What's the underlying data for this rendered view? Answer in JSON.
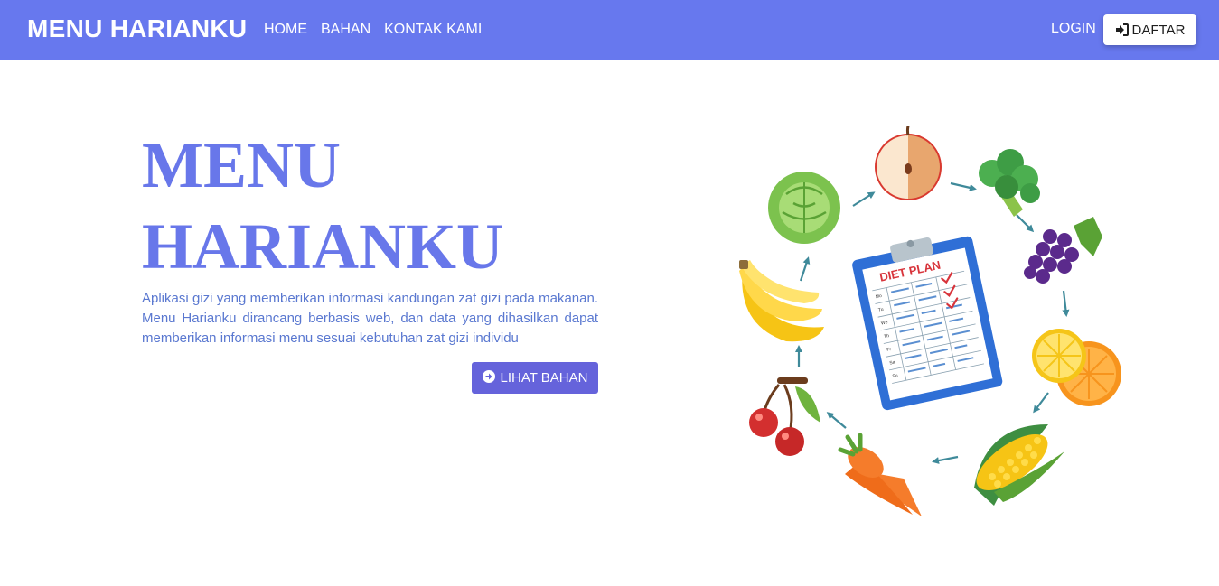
{
  "navbar": {
    "brand": "MENU HARIANKU",
    "links": [
      "HOME",
      "BAHAN",
      "KONTAK KAMI"
    ],
    "login": "LOGIN",
    "register": "DAFTAR",
    "register_icon": "sign-in-icon",
    "background": "#6778ee"
  },
  "hero": {
    "title_line1": "MENU",
    "title_line2": "HARIANKU",
    "description": "Aplikasi gizi yang memberikan informasi kandungan zat gizi pada makanan. Menu Harianku dirancang berbasis web, dan data yang dihasilkan dapat memberikan informasi menu sesuai kebutuhan zat gizi individu",
    "button_label": "LIHAT BAHAN",
    "button_icon": "arrow-circle-right-icon",
    "title_color": "#6877ea",
    "button_color": "#6563db"
  },
  "illustration": {
    "clipboard_title": "DIET PLAN",
    "day_labels": [
      "Mo",
      "Tu",
      "We",
      "Th",
      "Fr",
      "Sa",
      "Su"
    ],
    "items": [
      "apple",
      "broccoli",
      "grapes",
      "citrus",
      "corn",
      "carrot",
      "cherries",
      "banana",
      "cabbage"
    ]
  }
}
